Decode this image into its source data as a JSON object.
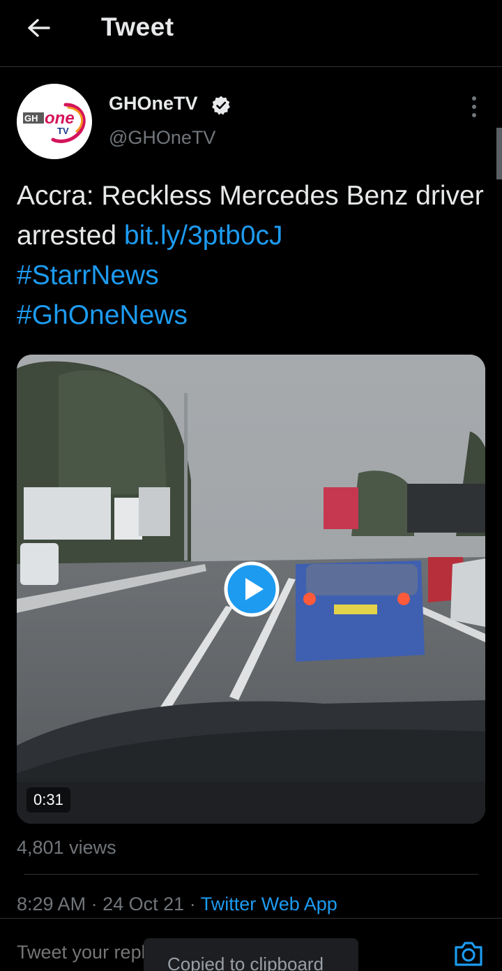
{
  "header": {
    "title": "Tweet",
    "back_icon": "arrow-left-icon"
  },
  "author": {
    "name": "GHOneTV",
    "handle": "@GHOneTV",
    "verified_icon": "verified-badge-icon",
    "avatar_logo_text": "GHOne TV"
  },
  "tweet": {
    "text": "Accra: Reckless Mercedes Benz driver arrested",
    "link": "bit.ly/3ptb0cJ",
    "hashtags": [
      "#StarrNews",
      "#GhOneNews"
    ]
  },
  "media": {
    "type": "video",
    "duration": "0:31",
    "play_icon": "play-icon"
  },
  "stats": {
    "views": "4,801 views"
  },
  "meta": {
    "time": "8:29 AM",
    "date": "24 Oct 21",
    "separator": "·",
    "source": "Twitter Web App"
  },
  "reply": {
    "placeholder": "Tweet your reply",
    "camera_icon": "camera-icon"
  },
  "toast": {
    "text": "Copied to clipboard"
  },
  "colors": {
    "accent": "#1d9bf0",
    "background": "#000000",
    "secondary_text": "#71767b"
  }
}
